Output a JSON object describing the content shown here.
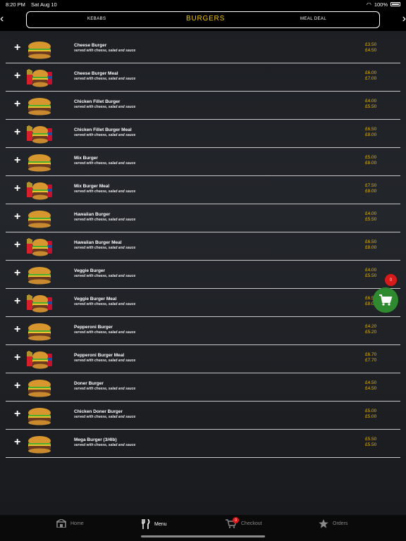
{
  "status_bar": {
    "time": "8:20 PM",
    "date": "Sat Aug 10",
    "battery": "100%"
  },
  "categories": {
    "left": "KEBABS",
    "active": "BURGERS",
    "right": "MEAL DEAL"
  },
  "items": [
    {
      "name": "Cheese Burger",
      "desc": "served with cheese, salad and sauce",
      "price1": "£3.50",
      "price2": "£4.50",
      "image": "burger"
    },
    {
      "name": "Cheese Burger Meal",
      "desc": "served with cheese, salad and sauce",
      "price1": "£6.00",
      "price2": "£7.00",
      "image": "burger-meal"
    },
    {
      "name": "Chicken Fillet Burger",
      "desc": "served with cheese, salad and sauce",
      "price1": "£4.00",
      "price2": "£5.50",
      "image": "burger"
    },
    {
      "name": "Chicken Fillet Burger Meal",
      "desc": "served with cheese, salad and sauce",
      "price1": "£6.50",
      "price2": "£8.00",
      "image": "burger-meal"
    },
    {
      "name": "Mix Burger",
      "desc": "served with cheese, salad and sauce",
      "price1": "£5.00",
      "price2": "£8.00",
      "image": "burger"
    },
    {
      "name": "Mix Burger Meal",
      "desc": "served with cheese, salad and sauce",
      "price1": "£7.50",
      "price2": "£8.00",
      "image": "burger-meal"
    },
    {
      "name": "Hawaiian Burger",
      "desc": "served with cheese, salad and sauce",
      "price1": "£4.00",
      "price2": "£5.50",
      "image": "burger"
    },
    {
      "name": "Hawaiian Burger Meal",
      "desc": "served with cheese, salad and sauce",
      "price1": "£6.50",
      "price2": "£8.00",
      "image": "burger-meal"
    },
    {
      "name": "Veggie Burger",
      "desc": "served with cheese, salad and sauce",
      "price1": "£4.00",
      "price2": "£5.50",
      "image": "burger"
    },
    {
      "name": "Veggie Burger Meal",
      "desc": "served with cheese, salad and sauce",
      "price1": "£6.5",
      "price2": "£8.0",
      "image": "burger-meal"
    },
    {
      "name": "Pepperoni Burger",
      "desc": "served with cheese, salad and sauce",
      "price1": "£4.20",
      "price2": "£5.20",
      "image": "burger"
    },
    {
      "name": "Pepperoni Burger Meal",
      "desc": "served with cheese, salad and sauce",
      "price1": "£6.70",
      "price2": "£7.70",
      "image": "burger-meal"
    },
    {
      "name": "Doner Burger",
      "desc": "served with cheese, salad and sauce",
      "price1": "£4.50",
      "price2": "£4.50",
      "image": "burger"
    },
    {
      "name": "Chicken Doner Burger",
      "desc": "served with cheese, salad and sauce",
      "price1": "£5.00",
      "price2": "£5.00",
      "image": "burger"
    },
    {
      "name": "Mega Burger (3/4lb)",
      "desc": "served with cheese, salad and sauce",
      "price1": "£5.50",
      "price2": "£5.50",
      "image": "burger"
    }
  ],
  "cart": {
    "count": "0"
  },
  "tab_bar": {
    "home": "Home",
    "menu": "Menu",
    "checkout": "Checkout",
    "checkout_badge": "0",
    "orders": "Orders"
  },
  "colors": {
    "price": "#e8b400",
    "active_category": "#f5c400",
    "cart": "#2f8a2f",
    "badge": "#d91a1a"
  }
}
